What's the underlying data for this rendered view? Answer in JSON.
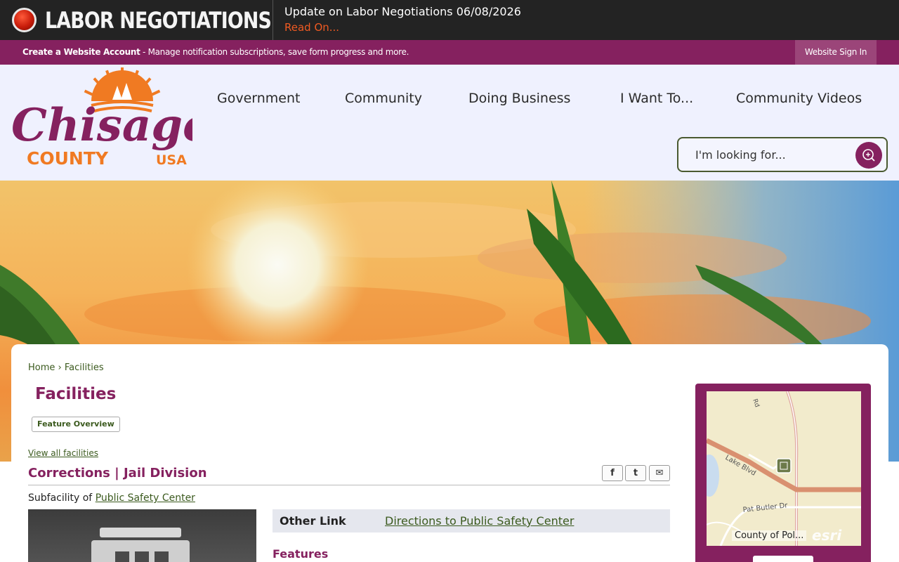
{
  "alert": {
    "title": "LABOR NEGOTIATIONS",
    "message": "Update on Labor Negotiations 06/08/2026",
    "link": "Read On..."
  },
  "account_bar": {
    "create_label": "Create a Website Account",
    "description": " - Manage notification subscriptions, save form progress and more.",
    "signin": "Website Sign In"
  },
  "logo": {
    "name": "Chisago",
    "county": "COUNTY",
    "country": "USA"
  },
  "nav": {
    "items": [
      "Government",
      "Community",
      "Doing Business",
      "I Want To...",
      "Community Videos"
    ]
  },
  "search": {
    "placeholder": "I'm looking for..."
  },
  "breadcrumb": {
    "home": "Home",
    "separator": "›",
    "current": "Facilities"
  },
  "page": {
    "title": "Facilities",
    "feature_overview": "Feature Overview",
    "view_all": "View all facilities",
    "facility_name": "Corrections | Jail Division",
    "subfacility_prefix": "Subfacility of ",
    "subfacility_link": "Public Safety Center",
    "other_link_label": "Other Link",
    "other_link_value": "Directions to Public Safety Center",
    "features_heading": "Features"
  },
  "share": {
    "facebook": "f",
    "twitter": "t",
    "email": "✉"
  },
  "map": {
    "road_1": "Lake Blvd",
    "road_2": "Pat Butler Dr",
    "road_3": "Rd",
    "attribution": "County of Pol...",
    "provider": "esri"
  },
  "colors": {
    "brand": "#85215f",
    "accent": "#f05a22",
    "link": "#3b5a1e"
  }
}
